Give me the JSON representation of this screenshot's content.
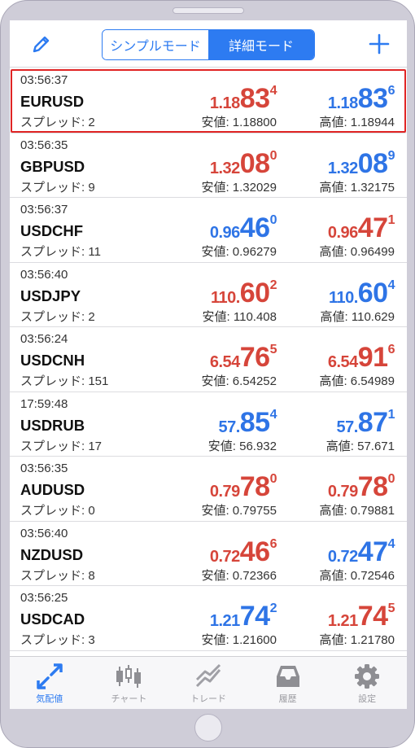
{
  "header": {
    "segments": [
      {
        "label": "シンプルモード",
        "active": false
      },
      {
        "label": "詳細モード",
        "active": true
      }
    ]
  },
  "quotes": [
    {
      "time": "03:56:37",
      "symbol": "EURUSD",
      "spread": "スプレッド: 2",
      "bid": {
        "a": "1.18",
        "b": "83",
        "c": "4",
        "color": "red"
      },
      "ask": {
        "a": "1.18",
        "b": "83",
        "c": "6",
        "color": "blue"
      },
      "low": "安値: 1.18800",
      "high": "高値: 1.18944",
      "selected": true
    },
    {
      "time": "03:56:35",
      "symbol": "GBPUSD",
      "spread": "スプレッド: 9",
      "bid": {
        "a": "1.32",
        "b": "08",
        "c": "0",
        "color": "red"
      },
      "ask": {
        "a": "1.32",
        "b": "08",
        "c": "9",
        "color": "blue"
      },
      "low": "安値: 1.32029",
      "high": "高値: 1.32175",
      "selected": false
    },
    {
      "time": "03:56:37",
      "symbol": "USDCHF",
      "spread": "スプレッド: 11",
      "bid": {
        "a": "0.96",
        "b": "46",
        "c": "0",
        "color": "blue"
      },
      "ask": {
        "a": "0.96",
        "b": "47",
        "c": "1",
        "color": "red"
      },
      "low": "安値: 0.96279",
      "high": "高値: 0.96499",
      "selected": false
    },
    {
      "time": "03:56:40",
      "symbol": "USDJPY",
      "spread": "スプレッド: 2",
      "bid": {
        "a": "110.",
        "b": "60",
        "c": "2",
        "color": "red"
      },
      "ask": {
        "a": "110.",
        "b": "60",
        "c": "4",
        "color": "blue"
      },
      "low": "安値: 110.408",
      "high": "高値: 110.629",
      "selected": false
    },
    {
      "time": "03:56:24",
      "symbol": "USDCNH",
      "spread": "スプレッド: 151",
      "bid": {
        "a": "6.54",
        "b": "76",
        "c": "5",
        "color": "red"
      },
      "ask": {
        "a": "6.54",
        "b": "91",
        "c": "6",
        "color": "red"
      },
      "low": "安値: 6.54252",
      "high": "高値: 6.54989",
      "selected": false
    },
    {
      "time": "17:59:48",
      "symbol": "USDRUB",
      "spread": "スプレッド: 17",
      "bid": {
        "a": "57.",
        "b": "85",
        "c": "4",
        "color": "blue"
      },
      "ask": {
        "a": "57.",
        "b": "87",
        "c": "1",
        "color": "blue"
      },
      "low": "安値: 56.932",
      "high": "高値: 57.671",
      "selected": false
    },
    {
      "time": "03:56:35",
      "symbol": "AUDUSD",
      "spread": "スプレッド: 0",
      "bid": {
        "a": "0.79",
        "b": "78",
        "c": "0",
        "color": "red"
      },
      "ask": {
        "a": "0.79",
        "b": "78",
        "c": "0",
        "color": "red"
      },
      "low": "安値: 0.79755",
      "high": "高値: 0.79881",
      "selected": false
    },
    {
      "time": "03:56:40",
      "symbol": "NZDUSD",
      "spread": "スプレッド: 8",
      "bid": {
        "a": "0.72",
        "b": "46",
        "c": "6",
        "color": "red"
      },
      "ask": {
        "a": "0.72",
        "b": "47",
        "c": "4",
        "color": "blue"
      },
      "low": "安値: 0.72366",
      "high": "高値: 0.72546",
      "selected": false
    },
    {
      "time": "03:56:25",
      "symbol": "USDCAD",
      "spread": "スプレッド: 3",
      "bid": {
        "a": "1.21",
        "b": "74",
        "c": "2",
        "color": "blue"
      },
      "ask": {
        "a": "1.21",
        "b": "74",
        "c": "5",
        "color": "red"
      },
      "low": "安値: 1.21600",
      "high": "高値: 1.21780",
      "selected": false
    }
  ],
  "tabs": [
    {
      "label": "気配値",
      "icon": "quotes-arrows-icon",
      "active": true
    },
    {
      "label": "チャート",
      "icon": "candlestick-icon",
      "active": false
    },
    {
      "label": "トレード",
      "icon": "trade-trend-icon",
      "active": false
    },
    {
      "label": "履歴",
      "icon": "history-tray-icon",
      "active": false
    },
    {
      "label": "設定",
      "icon": "gear-icon",
      "active": false
    }
  ],
  "colors": {
    "accent": "#2d7bf1",
    "red": "#d6453a",
    "blue": "#2e74e6",
    "selection": "#e02424"
  }
}
